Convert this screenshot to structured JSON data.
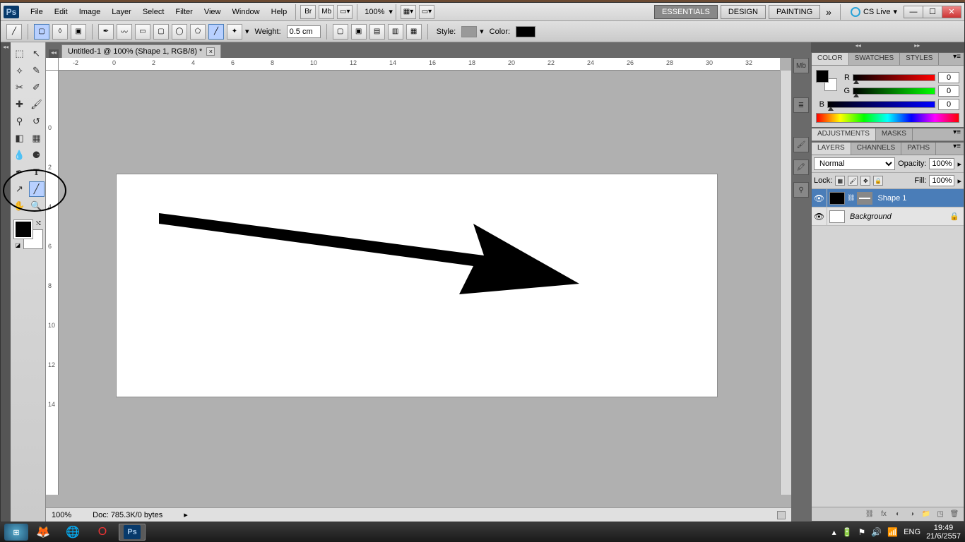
{
  "menubar": {
    "items": [
      "File",
      "Edit",
      "Image",
      "Layer",
      "Select",
      "Filter",
      "View",
      "Window",
      "Help"
    ],
    "zoom": "100%",
    "workspaces": [
      "ESSENTIALS",
      "DESIGN",
      "PAINTING"
    ],
    "cslive": "CS Live"
  },
  "optbar": {
    "weight_label": "Weight:",
    "weight_value": "0.5 cm",
    "style_label": "Style:",
    "color_label": "Color:"
  },
  "document": {
    "tab_title": "Untitled-1 @ 100% (Shape 1, RGB/8) *",
    "status_zoom": "100%",
    "status_doc": "Doc: 785.3K/0 bytes"
  },
  "ruler": {
    "h_marks": [
      -2,
      0,
      2,
      4,
      6,
      8,
      10,
      12,
      14,
      16,
      18,
      20,
      22,
      24,
      26,
      28,
      30,
      32
    ],
    "v_marks": [
      0,
      2,
      4,
      6,
      8,
      10,
      12,
      14
    ]
  },
  "color_panel": {
    "tabs": [
      "COLOR",
      "SWATCHES",
      "STYLES"
    ],
    "r": "0",
    "g": "0",
    "b": "0"
  },
  "adjustments_panel": {
    "tabs": [
      "ADJUSTMENTS",
      "MASKS"
    ]
  },
  "layers_panel": {
    "tabs": [
      "LAYERS",
      "CHANNELS",
      "PATHS"
    ],
    "blend": "Normal",
    "opacity_label": "Opacity:",
    "opacity": "100%",
    "lock_label": "Lock:",
    "fill_label": "Fill:",
    "fill": "100%",
    "layers": [
      {
        "name": "Shape 1",
        "selected": true,
        "bg": false
      },
      {
        "name": "Background",
        "selected": false,
        "bg": true
      }
    ]
  },
  "taskbar": {
    "lang": "ENG",
    "time": "19:49",
    "date": "21/6/2557"
  }
}
